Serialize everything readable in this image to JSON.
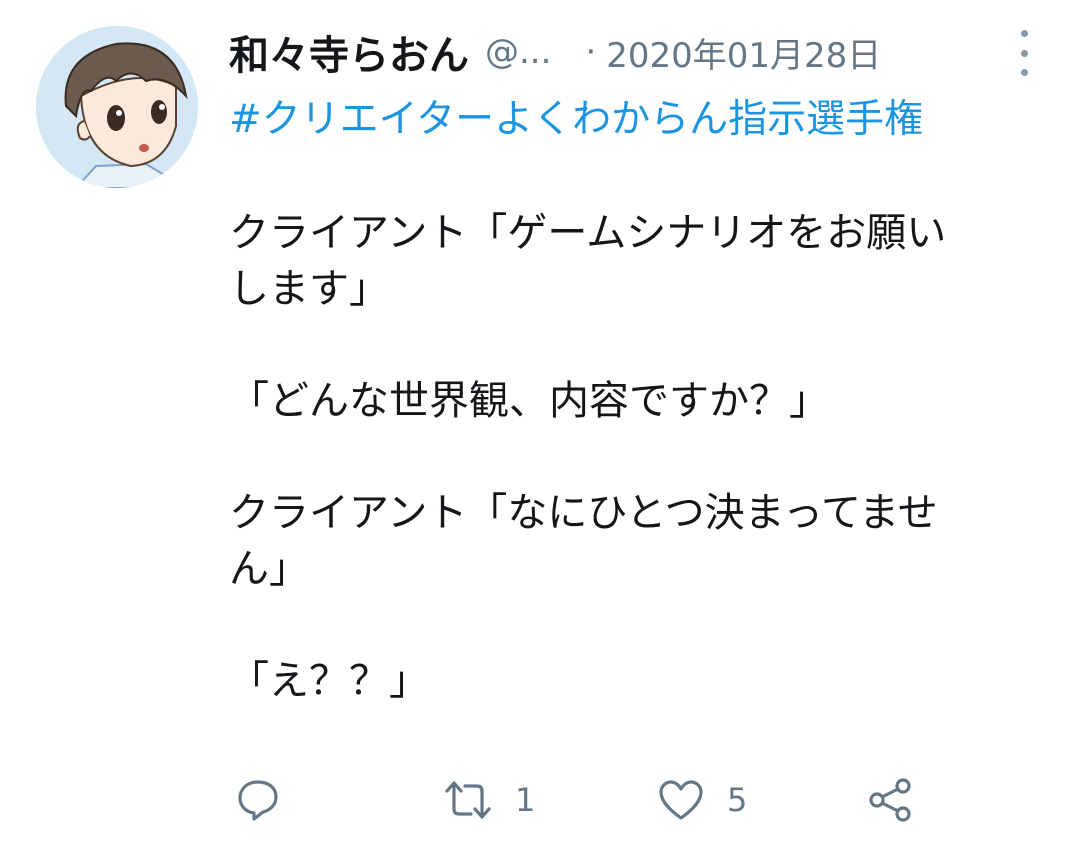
{
  "tweet": {
    "display_name": "和々寺らおん",
    "handle": "@...",
    "separator": "·",
    "date": "2020年01月28日",
    "hashtag": "#クリエイターよくわからん指示選手権",
    "lines": [
      "クライアント「ゲームシナリオをお願い",
      "します」",
      "",
      "「どんな世界観、内容ですか？」",
      "",
      "クライアント「なにひとつ決まってませ",
      "ん」",
      "",
      "「え？？」"
    ]
  },
  "actions": {
    "reply_icon": "reply-icon",
    "retweet_icon": "retweet-icon",
    "retweet_count": "1",
    "like_icon": "heart-icon",
    "like_count": "5",
    "share_icon": "share-icon"
  },
  "colors": {
    "hashtag": "#1b95e0",
    "secondary_text": "#657786",
    "primary_text": "#14171a",
    "icon": "#657786"
  }
}
